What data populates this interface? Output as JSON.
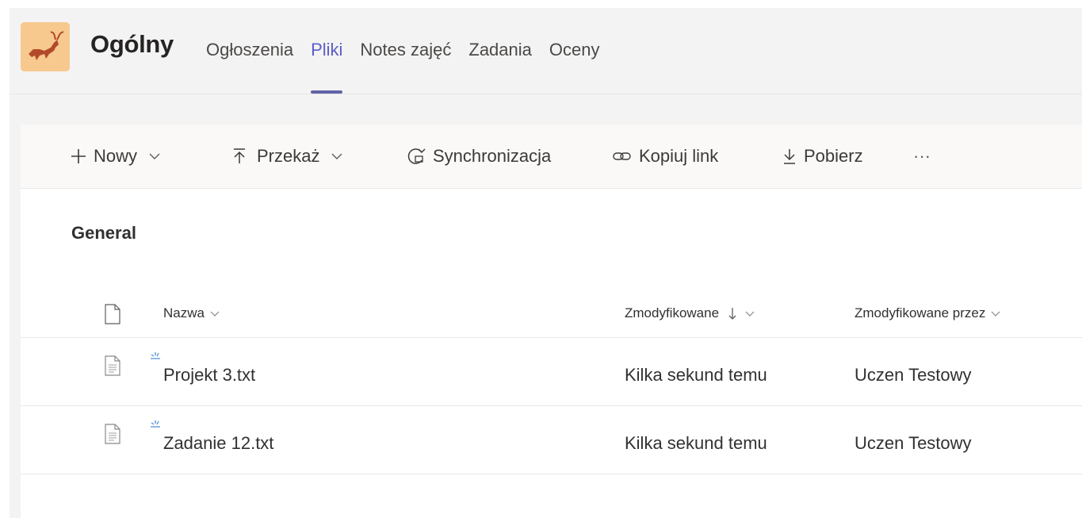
{
  "header": {
    "channel_title": "Ogólny",
    "tabs": [
      {
        "label": "Ogłoszenia",
        "active": false
      },
      {
        "label": "Pliki",
        "active": true
      },
      {
        "label": "Notes zajęć",
        "active": false
      },
      {
        "label": "Zadania",
        "active": false
      },
      {
        "label": "Oceny",
        "active": false
      }
    ]
  },
  "toolbar": {
    "new_label": "Nowy",
    "upload_label": "Przekaż",
    "sync_label": "Synchronizacja",
    "copy_link_label": "Kopiuj link",
    "download_label": "Pobierz",
    "more_label": "···"
  },
  "library": {
    "section_title": "General",
    "columns": {
      "name": "Nazwa",
      "modified": "Zmodyfikowane",
      "modified_by": "Zmodyfikowane przez"
    },
    "files": [
      {
        "name": "Projekt 3.txt",
        "modified": "Kilka sekund temu",
        "modified_by": "Uczen Testowy"
      },
      {
        "name": "Zadanie 12.txt",
        "modified": "Kilka sekund temu",
        "modified_by": "Uczen Testowy"
      }
    ]
  },
  "colors": {
    "accent": "#6264a7",
    "active_tab_text": "#5b5fc7",
    "sync_mark": "#4f8fd6",
    "logo_bg": "#f7c98f"
  }
}
